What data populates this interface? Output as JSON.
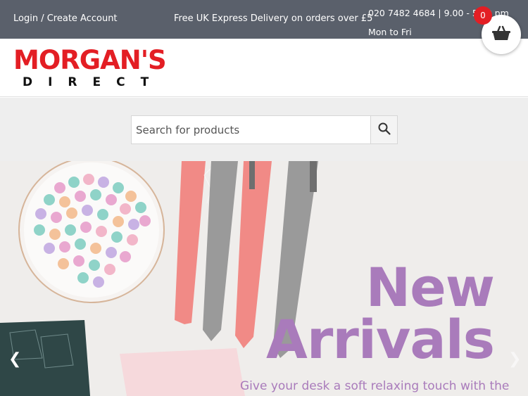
{
  "topbar": {
    "login_label": "Login / Create Account",
    "delivery_text": "Free UK Express Delivery on orders over £5",
    "phone_line1": "020 7482 4684 | 9.00 - 5.00 pm",
    "phone_line2": "Mon to Fri"
  },
  "logo": {
    "main_text": "MORGAN'S",
    "sub_text": "DIRECT"
  },
  "cart": {
    "count": "0",
    "icon": "basket-icon"
  },
  "search": {
    "placeholder": "Search for products",
    "icon": "search-icon"
  },
  "hero": {
    "title_line1": "New",
    "title_line2": "Arrivals",
    "subtitle": "Give your desk a soft relaxing touch with the",
    "prev_icon": "chevron-left-icon",
    "next_icon": "chevron-right-icon"
  },
  "colors": {
    "topbar_bg": "#5a606b",
    "brand_red": "#e31e24",
    "hero_purple": "#a97bbb"
  }
}
